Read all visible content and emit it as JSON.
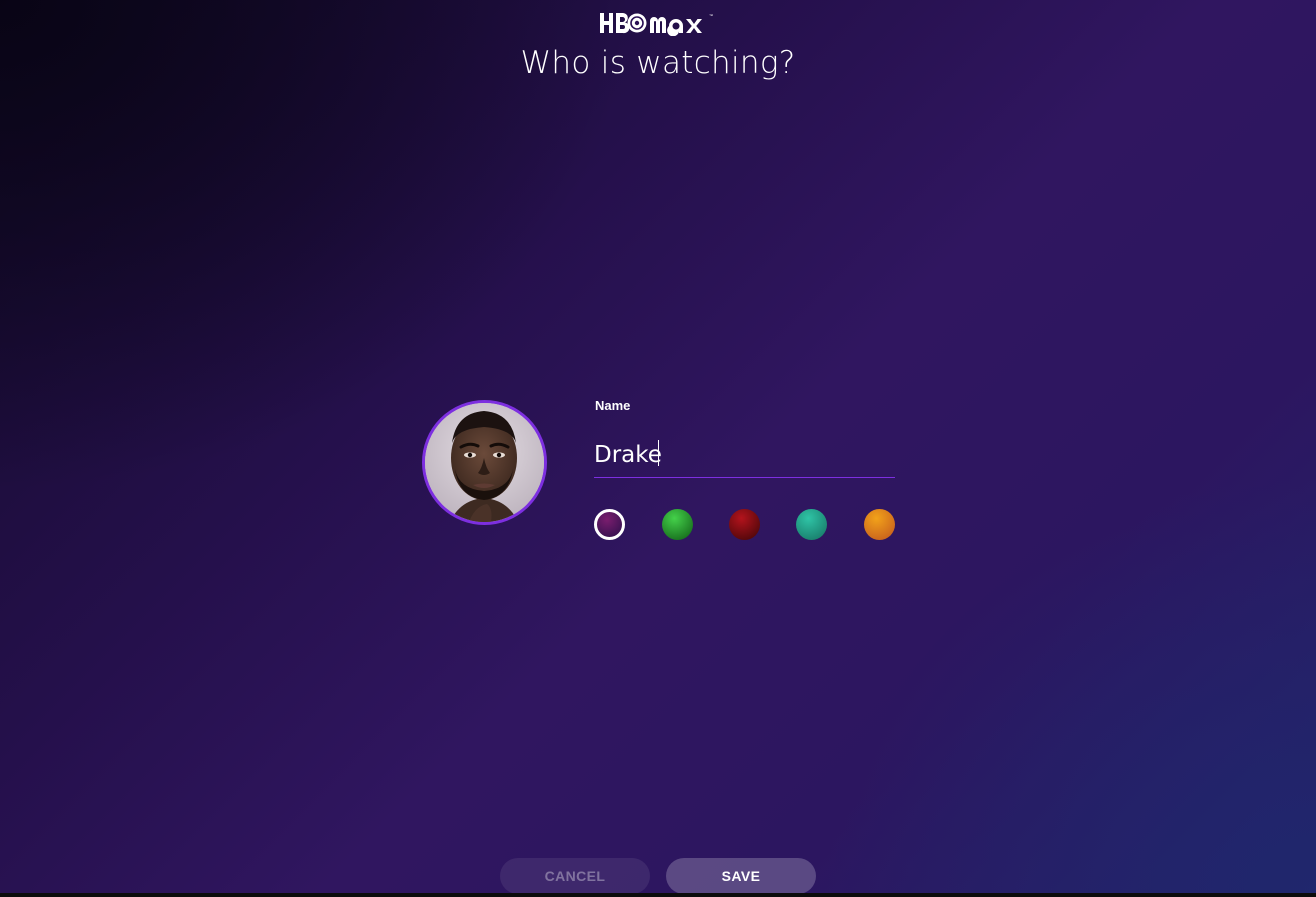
{
  "brand": {
    "logo_text": "HBOmax"
  },
  "header": {
    "title": "Who is watching?"
  },
  "profile": {
    "avatar_alt": "Profile photo",
    "name_label": "Name",
    "name_value": "Drake",
    "selected_color_index": 0,
    "colors": [
      {
        "name": "magenta",
        "from": "#7a1d6e",
        "to": "#2a0f4a"
      },
      {
        "name": "green",
        "from": "#44d14a",
        "to": "#0e5a14"
      },
      {
        "name": "red",
        "from": "#b3131c",
        "to": "#3d0507"
      },
      {
        "name": "teal",
        "from": "#2fc4a6",
        "to": "#157060"
      },
      {
        "name": "orange",
        "from": "#f2a21a",
        "to": "#c0551d"
      }
    ]
  },
  "actions": {
    "cancel_label": "CANCEL",
    "save_label": "SAVE"
  },
  "theme": {
    "accent": "#7d2fe0",
    "text": "#ffffff"
  }
}
